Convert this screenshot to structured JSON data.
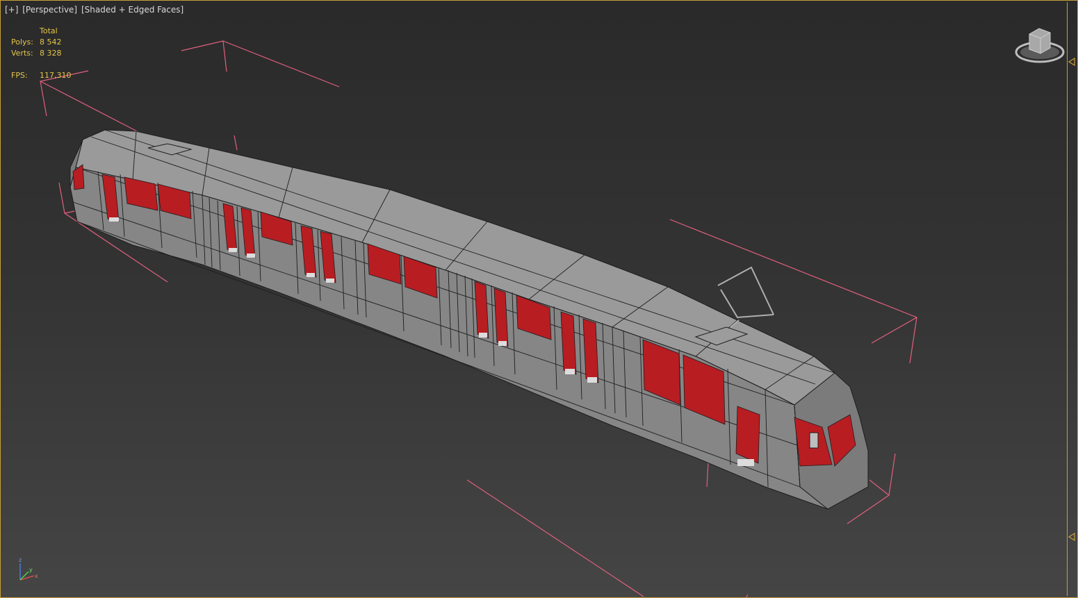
{
  "viewport": {
    "labels": [
      "[+]",
      "[Perspective]",
      "[Shaded + Edged Faces]"
    ]
  },
  "stats": {
    "total_label": "Total",
    "polys_label": "Polys:",
    "polys_value": "8 542",
    "verts_label": "Verts:",
    "verts_value": "8 328",
    "fps_label": "FPS:",
    "fps_value": "117,310"
  },
  "axis": {
    "z": "z",
    "x": "x",
    "y": "y"
  },
  "colors": {
    "viewport_border": "#c8a03a",
    "stats_text": "#e6c54a",
    "bounding_box": "#e0607e",
    "window_red": "#b81d22",
    "tram_body": "#8e8e8e"
  },
  "icons": [
    "viewcube-icon",
    "right-edge-arrow-icon",
    "axis-tripod-icon"
  ]
}
